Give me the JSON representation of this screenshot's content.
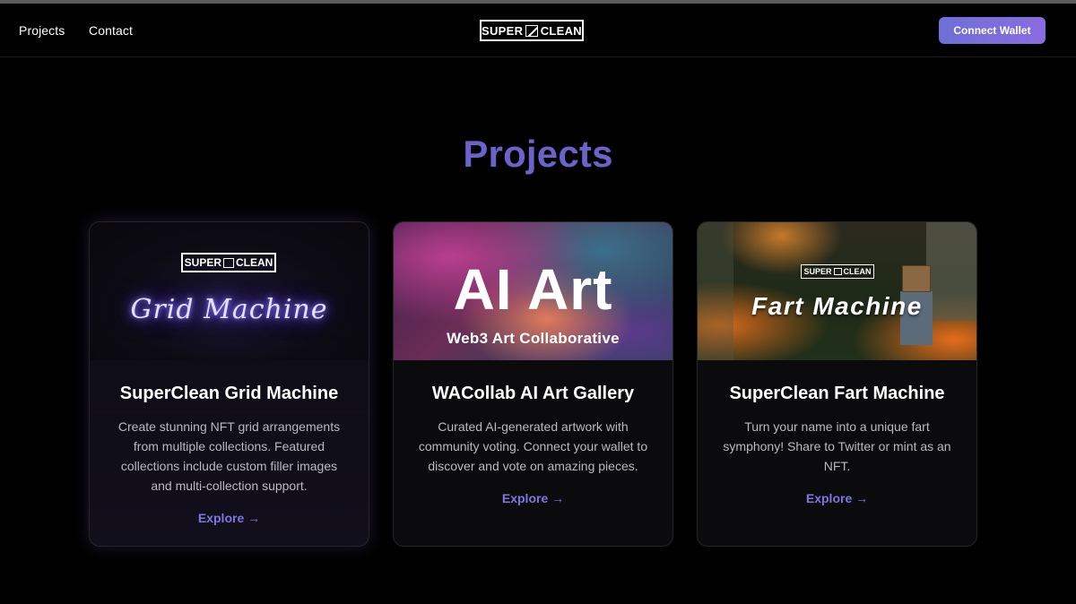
{
  "nav": {
    "projects_label": "Projects",
    "contact_label": "Contact",
    "logo_left": "SUPER",
    "logo_right": "CLEAN",
    "connect_wallet_label": "Connect Wallet"
  },
  "page": {
    "title": "Projects"
  },
  "cards": [
    {
      "banner_logo_left": "SUPER",
      "banner_logo_right": "CLEAN",
      "banner_text": "Grid Machine",
      "title": "SuperClean Grid Machine",
      "description": "Create stunning NFT grid arrangements from multiple collections. Featured collections include custom filler images and multi-collection support.",
      "link_label": "Explore →"
    },
    {
      "banner_text": "AI Art",
      "banner_subtext": "Web3 Art Collaborative",
      "title": "WACollab AI Art Gallery",
      "description": "Curated AI-generated artwork with community voting. Connect your wallet to discover and vote on amazing pieces.",
      "link_label": "Explore →"
    },
    {
      "banner_logo_left": "SUPER",
      "banner_logo_right": "CLEAN",
      "banner_text": "Fart Machine",
      "title": "SuperClean Fart Machine",
      "description": "Turn your name into a unique fart symphony! Share to Twitter or mint as an NFT.",
      "link_label": "Explore →"
    }
  ],
  "colors": {
    "accent": "#6a63c9",
    "link": "#7b77e0",
    "button_gradient_start": "#6f6fd6",
    "button_gradient_end": "#8a6ce0",
    "background": "#000000"
  }
}
